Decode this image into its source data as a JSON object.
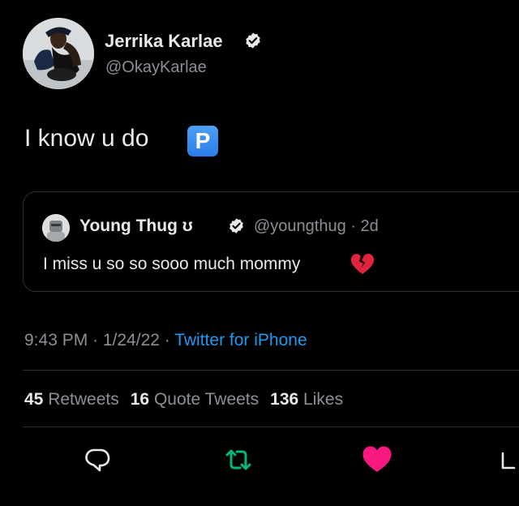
{
  "author": {
    "display_name": "Jerrika Karlae",
    "handle": "@OkayKarlae",
    "verified_icon": "verified-badge-icon"
  },
  "tweet": {
    "text": "I know u do",
    "emoji": "P"
  },
  "quoted": {
    "display_name": "Young Thug",
    "name_symbol": "ʊ",
    "handle_and_time": "@youngthug · 2d",
    "text": "I miss u so so sooo much mommy",
    "emoji_icon": "broken-heart-icon"
  },
  "meta": {
    "time_date": "9:43 PM · 1/24/22 · ",
    "source": "Twitter for iPhone"
  },
  "stats": {
    "retweets_count": "45",
    "retweets_label": "Retweets",
    "quotes_count": "16",
    "quotes_label": "Quote Tweets",
    "likes_count": "136",
    "likes_label": "Likes"
  },
  "actions": {
    "reply_icon": "reply-icon",
    "retweet_icon": "retweet-icon",
    "like_icon": "heart-icon",
    "share_icon": "share-icon"
  },
  "colors": {
    "background": "#000000",
    "primary_text": "#e7e9ea",
    "secondary_text": "#8b9096",
    "link": "#1d9bf0",
    "retweet_green": "#00ba7c",
    "like_pink": "#f91880",
    "border": "#2a2f33"
  }
}
